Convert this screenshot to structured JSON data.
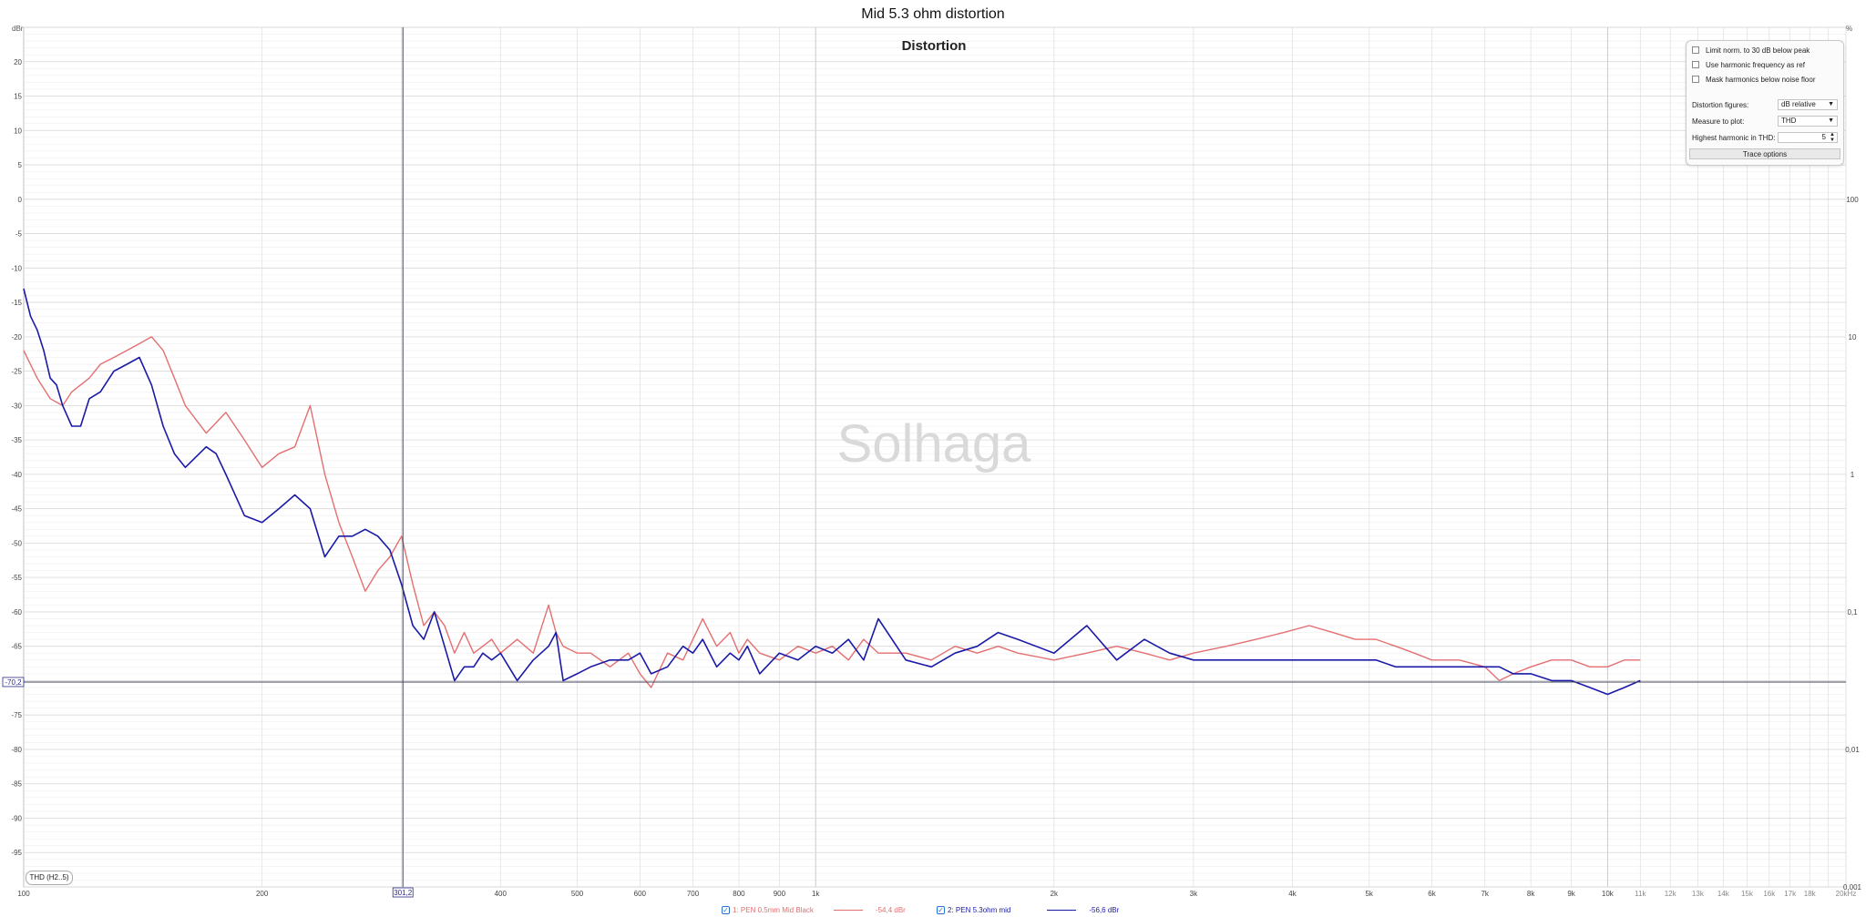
{
  "title": "Mid 5.3 ohm distortion",
  "panel_title": "Distortion",
  "watermark": "Solhaga",
  "colors": {
    "series1": "#e46f70",
    "series2": "#1a1aa8",
    "grid": "#e3e3e3",
    "gridMajor": "#c8c8c8",
    "cursor": "#33335a"
  },
  "controls": {
    "limit_norm": "Limit norm. to 30 dB below peak",
    "use_harmonic_ref": "Use harmonic frequency as ref",
    "mask_harmonics": "Mask harmonics below noise floor",
    "distortion_figures_label": "Distortion figures:",
    "distortion_figures_value": "dB relative",
    "measure_label": "Measure to plot:",
    "measure_value": "THD",
    "highest_harmonic_label": "Highest harmonic in THD:",
    "highest_harmonic_value": "5",
    "trace_options": "Trace options"
  },
  "bottom_box": "THD (H2..5)",
  "cursor": {
    "x_label": "301,2",
    "y_label": "-70,2",
    "x_value": 301.2,
    "y_value": -70.2
  },
  "legend": {
    "s1_label": "1: PEN 0.5mm Mid Black",
    "s1_value": "-54,4 dBr",
    "s2_label": "2: PEN 5.3ohm mid",
    "s2_value": "-56,6 dBr"
  },
  "chart_data": {
    "type": "line",
    "title": "Distortion",
    "xlabel": "",
    "ylabel": "dBr",
    "y2label": "%",
    "x_scale": "log",
    "xlim": [
      100,
      20000
    ],
    "ylim": [
      -100,
      25
    ],
    "grid": true,
    "y_ticks": [
      "20",
      "15",
      "10",
      "5",
      "0",
      "-5",
      "-10",
      "-15",
      "-20",
      "-25",
      "-30",
      "-35",
      "-40",
      "-45",
      "-50",
      "-55",
      "-60",
      "-65",
      "-70",
      "-75",
      "-80",
      "-85",
      "-90",
      "-95"
    ],
    "y2_ticks": [
      "100",
      "10",
      "1",
      "0,1",
      "0,01",
      "0,001"
    ],
    "x_ticks": [
      "100",
      "200",
      "300",
      "400",
      "500",
      "600",
      "700",
      "800",
      "900",
      "1k",
      "2k",
      "3k",
      "4k",
      "5k",
      "6k",
      "7k",
      "8k",
      "9k",
      "10k",
      "11k",
      "12k",
      "13k",
      "14k",
      "15k",
      "16k",
      "17k",
      "18k",
      "20kHz"
    ],
    "series": [
      {
        "name": "1: PEN 0.5mm Mid Black",
        "x": [
          100,
          104,
          108,
          112,
          115,
          118,
          121,
          125,
          130,
          135,
          140,
          145,
          150,
          155,
          160,
          170,
          180,
          190,
          200,
          210,
          220,
          230,
          240,
          250,
          260,
          270,
          280,
          290,
          300,
          310,
          320,
          330,
          340,
          350,
          360,
          370,
          380,
          390,
          400,
          420,
          440,
          460,
          470,
          480,
          500,
          520,
          550,
          580,
          600,
          620,
          650,
          680,
          700,
          720,
          750,
          780,
          800,
          820,
          850,
          900,
          950,
          1000,
          1050,
          1100,
          1150,
          1200,
          1300,
          1400,
          1500,
          1600,
          1700,
          1800,
          2000,
          2200,
          2400,
          2600,
          2800,
          3000,
          3300,
          3600,
          3900,
          4200,
          4500,
          4800,
          5100,
          5400,
          5700,
          6000,
          6500,
          7000,
          7300,
          7600,
          8000,
          8500,
          9000,
          9500,
          10000,
          10500,
          11000
        ],
        "values": [
          -22,
          -26,
          -29,
          -30,
          -28,
          -27,
          -26,
          -24,
          -23,
          -22,
          -21,
          -20,
          -22,
          -26,
          -30,
          -34,
          -31,
          -35,
          -39,
          -37,
          -36,
          -30,
          -40,
          -47,
          -52,
          -57,
          -54,
          -52,
          -49,
          -56,
          -62,
          -60,
          -62,
          -66,
          -63,
          -66,
          -65,
          -64,
          -66,
          -64,
          -66,
          -59,
          -63,
          -65,
          -66,
          -66,
          -68,
          -66,
          -69,
          -71,
          -66,
          -67,
          -64,
          -61,
          -65,
          -63,
          -66,
          -64,
          -66,
          -67,
          -65,
          -66,
          -65,
          -67,
          -64,
          -66,
          -66,
          -67,
          -65,
          -66,
          -65,
          -66,
          -67,
          -66,
          -65,
          -66,
          -67,
          -66,
          -65,
          -64,
          -63,
          -62,
          -63,
          -64,
          -64,
          -65,
          -66,
          -67,
          -67,
          -68,
          -70,
          -69,
          -68,
          -67,
          -67,
          -68,
          -68,
          -67,
          -67
        ]
      },
      {
        "name": "2: PEN 5.3ohm mid",
        "x": [
          100,
          102,
          104,
          106,
          108,
          110,
          112,
          115,
          118,
          121,
          125,
          130,
          135,
          140,
          145,
          150,
          155,
          160,
          170,
          175,
          180,
          190,
          200,
          210,
          220,
          230,
          240,
          250,
          260,
          270,
          280,
          290,
          300,
          310,
          320,
          330,
          340,
          350,
          360,
          370,
          380,
          390,
          400,
          420,
          440,
          460,
          470,
          480,
          500,
          520,
          550,
          580,
          600,
          620,
          650,
          680,
          700,
          720,
          750,
          780,
          800,
          820,
          850,
          900,
          950,
          1000,
          1050,
          1100,
          1150,
          1200,
          1300,
          1400,
          1500,
          1600,
          1700,
          1800,
          2000,
          2200,
          2400,
          2600,
          2800,
          3000,
          3300,
          3600,
          3900,
          4200,
          4500,
          4800,
          5100,
          5400,
          5700,
          6000,
          6500,
          7000,
          7300,
          7600,
          8000,
          8500,
          9000,
          9500,
          10000,
          10500,
          11000
        ],
        "values": [
          -13,
          -17,
          -19,
          -22,
          -26,
          -27,
          -30,
          -33,
          -33,
          -29,
          -28,
          -25,
          -24,
          -23,
          -27,
          -33,
          -37,
          -39,
          -36,
          -37,
          -40,
          -46,
          -47,
          -45,
          -43,
          -45,
          -52,
          -49,
          -49,
          -48,
          -49,
          -51,
          -56,
          -62,
          -64,
          -60,
          -65,
          -70,
          -68,
          -68,
          -66,
          -67,
          -66,
          -70,
          -67,
          -65,
          -63,
          -70,
          -69,
          -68,
          -67,
          -67,
          -66,
          -69,
          -68,
          -65,
          -66,
          -64,
          -68,
          -66,
          -67,
          -65,
          -69,
          -66,
          -67,
          -65,
          -66,
          -64,
          -67,
          -61,
          -67,
          -68,
          -66,
          -65,
          -63,
          -64,
          -66,
          -62,
          -67,
          -64,
          -66,
          -67,
          -67,
          -67,
          -67,
          -67,
          -67,
          -67,
          -67,
          -68,
          -68,
          -68,
          -68,
          -68,
          -68,
          -69,
          -69,
          -70,
          -70,
          -71,
          -72,
          -71,
          -70
        ]
      }
    ]
  }
}
